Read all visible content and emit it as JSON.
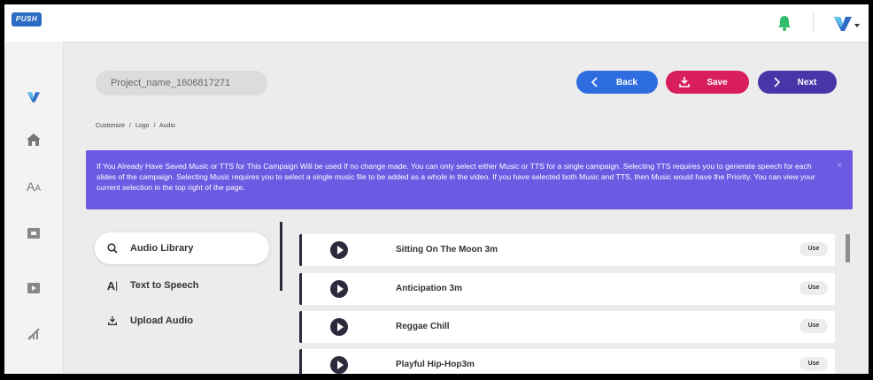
{
  "header": {
    "logo_text": "PUSH",
    "bell_color": "#2ebd6b",
    "brand_color": "#2d6bc4"
  },
  "sidebar": {
    "items": [
      {
        "name": "brand-v-icon"
      },
      {
        "name": "home-icon"
      },
      {
        "name": "text-size-icon"
      },
      {
        "name": "logo-icon"
      },
      {
        "name": "video-icon"
      },
      {
        "name": "chart-icon"
      }
    ]
  },
  "project": {
    "name": "Project_name_1606817271"
  },
  "toolbar": {
    "back_label": "Back",
    "save_label": "Save",
    "next_label": "Next"
  },
  "breadcrumb": {
    "items": [
      "Customize",
      "/",
      "Logo",
      "/",
      "Audio"
    ]
  },
  "alert": {
    "text": "If You Already Have Saved Music or TTS for This Campaign Will be used If no change made. You can only select either Music or TTS for a single campaign. Selecting TTS requires you to generate speech for each slides of the campaign. Selecting Music requires you to select a single music file to be added as a whole in the video. If you have selected both Music and TTS, then Music would have the Priority. You can view your current selection in the top right of the page.",
    "close": "×",
    "color": "#6d5ae3"
  },
  "options": [
    {
      "label": "Audio Library",
      "icon": "search-icon",
      "active": true
    },
    {
      "label": "Text to Speech",
      "icon": "text-cursor-icon",
      "active": false
    },
    {
      "label": "Upload Audio",
      "icon": "upload-icon",
      "active": false
    }
  ],
  "tracks": [
    {
      "title": "Sitting On The Moon 3m",
      "use_label": "Use"
    },
    {
      "title": "Anticipation 3m",
      "use_label": "Use"
    },
    {
      "title": "Reggae Chill",
      "use_label": "Use"
    },
    {
      "title": "Playful Hip-Hop3m",
      "use_label": "Use"
    }
  ]
}
